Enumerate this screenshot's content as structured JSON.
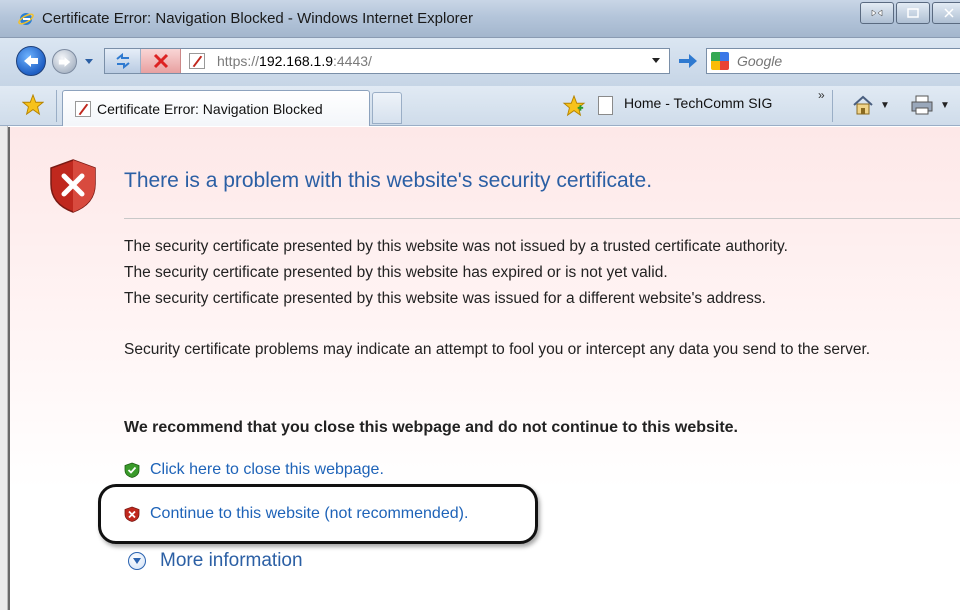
{
  "window": {
    "title": "Certificate Error: Navigation Blocked - Windows Internet Explorer",
    "minimize_label": "",
    "restore_label": ""
  },
  "address_bar": {
    "url_prefix": "https://",
    "url_host": "192.168.1.9",
    "url_suffix": ":4443/"
  },
  "search": {
    "placeholder": "Google"
  },
  "tabs": [
    {
      "label": "Certificate Error: Navigation Blocked"
    }
  ],
  "links_bar": {
    "item": "Home - TechComm SIG",
    "overflow": "»"
  },
  "content": {
    "heading": "There is a problem with this website's security certificate.",
    "reasons": [
      "The security certificate presented by this website was not issued by a trusted certificate authority.",
      "The security certificate presented by this website has expired or is not yet valid.",
      "The security certificate presented by this website was issued for a different website's address."
    ],
    "warning": "Security certificate problems may indicate an attempt to fool you or intercept any data you send to the server.",
    "recommendation": "We recommend that you close this webpage and do not continue to this website.",
    "close_link": "Click here to close this webpage.",
    "continue_link": "Continue to this website (not recommended).",
    "more_info": "More information"
  },
  "colors": {
    "heading": "#2b5fa4",
    "link": "#1e63b8",
    "error_red": "#c0281e",
    "safe_green": "#3a9a2a"
  }
}
